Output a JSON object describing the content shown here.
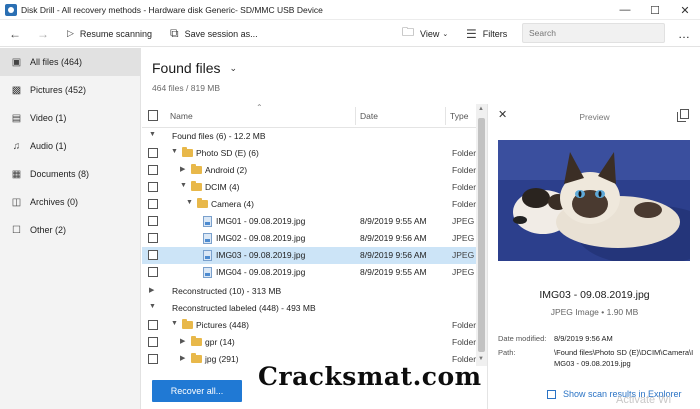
{
  "window": {
    "title": "Disk Drill - All recovery methods - Hardware disk Generic- SD/MMC USB Device",
    "controls": [
      "minimize-icon",
      "maximize-icon",
      "close-icon"
    ]
  },
  "toolbar": {
    "resume_label": "Resume scanning",
    "save_label": "Save session as...",
    "view_label": "View",
    "filters_label": "Filters",
    "search_placeholder": "Search",
    "more_label": "…"
  },
  "sidebar": {
    "items": [
      {
        "label": "All files (464)",
        "icon": "all-files-icon",
        "active": true
      },
      {
        "label": "Pictures (452)",
        "icon": "picture-icon",
        "active": false
      },
      {
        "label": "Video (1)",
        "icon": "video-icon",
        "active": false
      },
      {
        "label": "Audio (1)",
        "icon": "audio-icon",
        "active": false
      },
      {
        "label": "Documents (8)",
        "icon": "document-icon",
        "active": false
      },
      {
        "label": "Archives (0)",
        "icon": "archive-icon",
        "active": false
      },
      {
        "label": "Other (2)",
        "icon": "other-icon",
        "active": false
      }
    ]
  },
  "main": {
    "title": "Found files",
    "subtitle": "464 files / 819 MB"
  },
  "table": {
    "columns": {
      "name": "Name",
      "date": "Date",
      "type": "Type"
    },
    "rows": [
      {
        "kind": "group",
        "name": "Found files (6) - 12.2 MB",
        "date": "",
        "type": ""
      },
      {
        "kind": "folder",
        "name": "Photo SD (E) (6)",
        "date": "",
        "type": "Folder"
      },
      {
        "kind": "folder",
        "name": "Android (2)",
        "date": "",
        "type": "Folder"
      },
      {
        "kind": "folder",
        "name": "DCIM (4)",
        "date": "",
        "type": "Folder"
      },
      {
        "kind": "folder",
        "name": "Camera (4)",
        "date": "",
        "type": "Folder"
      },
      {
        "kind": "file",
        "name": "IMG01 - 09.08.2019.jpg",
        "date": "8/9/2019 9:55 AM",
        "type": "JPEG Im"
      },
      {
        "kind": "file",
        "name": "IMG02 - 09.08.2019.jpg",
        "date": "8/9/2019 9:56 AM",
        "type": "JPEG Im"
      },
      {
        "kind": "file",
        "name": "IMG03 - 09.08.2019.jpg",
        "date": "8/9/2019 9:56 AM",
        "type": "JPEG Im"
      },
      {
        "kind": "file",
        "name": "IMG04 - 09.08.2019.jpg",
        "date": "8/9/2019 9:55 AM",
        "type": "JPEG Im"
      },
      {
        "kind": "group",
        "name": "Reconstructed (10) - 313 MB",
        "date": "",
        "type": ""
      },
      {
        "kind": "group",
        "name": "Reconstructed labeled (448) - 493 MB",
        "date": "",
        "type": ""
      },
      {
        "kind": "folder",
        "name": "Pictures (448)",
        "date": "",
        "type": "Folder"
      },
      {
        "kind": "folder",
        "name": "gpr (14)",
        "date": "",
        "type": "Folder"
      },
      {
        "kind": "folder",
        "name": "jpg (291)",
        "date": "",
        "type": "Folder"
      }
    ]
  },
  "preview": {
    "title": "Preview",
    "file_name": "IMG03 - 09.08.2019.jpg",
    "file_type": "JPEG Image • 1.90 MB",
    "date_modified_label": "Date modified:",
    "date_modified": "8/9/2019 9:56 AM",
    "path_label": "Path:",
    "path": "\\Found files\\Photo SD (E)\\DCIM\\Camera\\IMG03 - 09.08.2019.jpg",
    "show_in_explorer": "Show scan results in Explorer"
  },
  "footer": {
    "recover_label": "Recover all..."
  },
  "overlay": {
    "watermark": "Cracksmat.com",
    "activate": "Activate Wi"
  },
  "colors": {
    "accent": "#2079d4",
    "selection": "#cce4f7",
    "sidebar_bg": "#f3f3f3",
    "folder": "#e8b84a",
    "link": "#2a73c5"
  }
}
